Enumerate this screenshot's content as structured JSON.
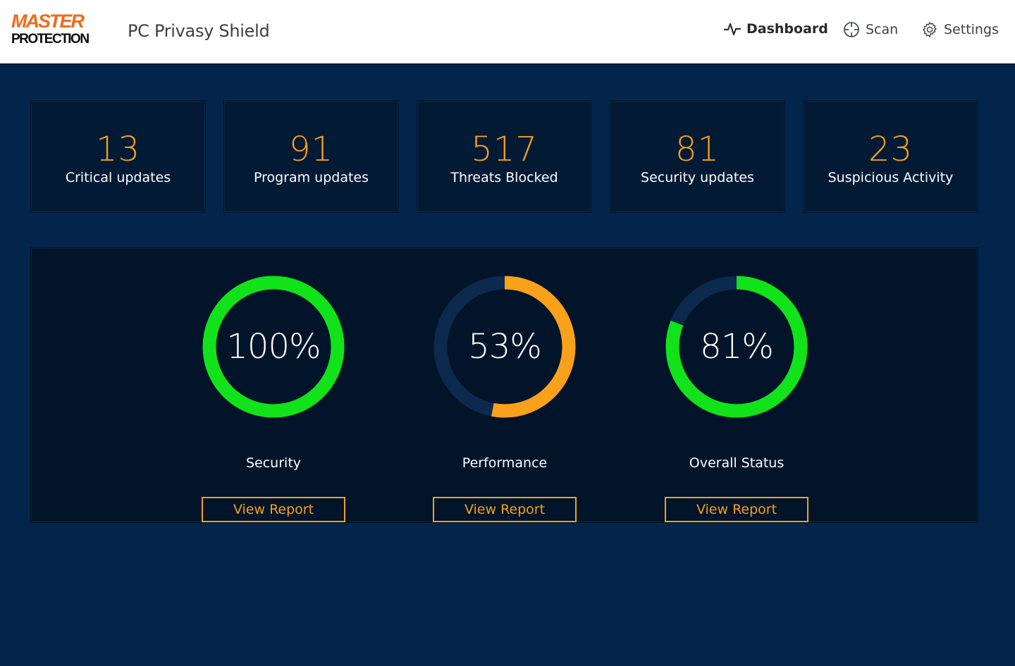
{
  "brand": {
    "logo_line1": "MASTER",
    "logo_line2": "PROTECTION",
    "app_title": "PC Privasy Shield"
  },
  "nav": [
    {
      "label": "Dashboard",
      "icon": "activity-icon",
      "active": true
    },
    {
      "label": "Scan",
      "icon": "crosshair-icon",
      "active": false
    },
    {
      "label": "Settings",
      "icon": "gear-icon",
      "active": false
    }
  ],
  "stats": [
    {
      "value": "13",
      "label": "Critical updates"
    },
    {
      "value": "91",
      "label": "Program updates"
    },
    {
      "value": "517",
      "label": "Threats Blocked"
    },
    {
      "value": "81",
      "label": "Security updates"
    },
    {
      "value": "23",
      "label": "Suspicious Activity"
    }
  ],
  "gauges": [
    {
      "percent": 100,
      "percent_label": "100%",
      "label": "Security",
      "color": "#12e21a",
      "button": "View Report"
    },
    {
      "percent": 53,
      "percent_label": "53%",
      "label": "Performance",
      "color": "#f9a11b",
      "button": "View Report"
    },
    {
      "percent": 81,
      "percent_label": "81%",
      "label": "Overall Status",
      "color": "#12e21a",
      "button": "View Report"
    }
  ],
  "colors": {
    "background": "#04254b",
    "card": "#031a35",
    "accent": "#f5a01c",
    "track": "#0c2a4e"
  }
}
